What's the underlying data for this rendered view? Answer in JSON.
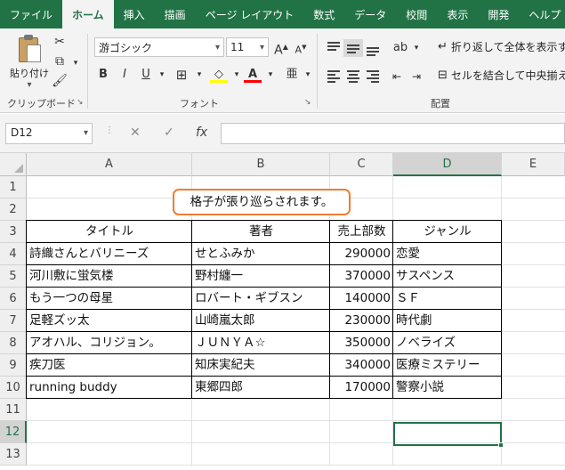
{
  "ribbon_tabs": [
    {
      "label": "ファイル",
      "active": false
    },
    {
      "label": "ホーム",
      "active": true
    },
    {
      "label": "挿入",
      "active": false
    },
    {
      "label": "描画",
      "active": false
    },
    {
      "label": "ページ レイアウト",
      "active": false
    },
    {
      "label": "数式",
      "active": false
    },
    {
      "label": "データ",
      "active": false
    },
    {
      "label": "校閲",
      "active": false
    },
    {
      "label": "表示",
      "active": false
    },
    {
      "label": "開発",
      "active": false
    },
    {
      "label": "ヘルプ",
      "active": false
    }
  ],
  "clipboard": {
    "paste_label": "貼り付け",
    "group_label": "クリップボード"
  },
  "font": {
    "name": "游ゴシック",
    "size": "11",
    "group_label": "フォント",
    "bold": "B",
    "italic": "I",
    "underline": "U",
    "grow": "A",
    "shrink": "A",
    "font_color_glyph": "A"
  },
  "alignment": {
    "group_label": "配置",
    "wrap_text": "折り返して全体を表示する",
    "merge_center": "セルを結合して中央揃え"
  },
  "formula_bar": {
    "name_box": "D12",
    "fx": "fx",
    "formula": ""
  },
  "columns": [
    "A",
    "B",
    "C",
    "D",
    "E"
  ],
  "selected_column": "D",
  "rows": [
    "1",
    "2",
    "3",
    "4",
    "5",
    "6",
    "7",
    "8",
    "9",
    "10",
    "11",
    "12",
    "13"
  ],
  "selected_row": "12",
  "callout_text": "格子が張り巡らされます。",
  "table": {
    "headers": [
      "タイトル",
      "著者",
      "売上部数",
      "ジャンル"
    ],
    "rows": [
      [
        "詩織さんとバリニーズ",
        "せとふみか",
        "290000",
        "恋愛"
      ],
      [
        "河川敷に蛍気楼",
        "野村纏一",
        "370000",
        "サスペンス"
      ],
      [
        "もう一つの母星",
        "ロバート・ギブスン",
        "140000",
        "ＳＦ"
      ],
      [
        "足軽ズッ太",
        "山崎嵐太郎",
        "230000",
        "時代劇"
      ],
      [
        "アオハル、コリジョン。",
        "ＪＵＮＹＡ☆",
        "350000",
        "ノベライズ"
      ],
      [
        "疾刀医",
        "知床実紀夫",
        "340000",
        "医療ミステリー"
      ],
      [
        "running buddy",
        "東郷四郎",
        "170000",
        "警察小説"
      ]
    ]
  },
  "colors": {
    "accent": "#217346",
    "callout_border": "#ed7d31"
  }
}
